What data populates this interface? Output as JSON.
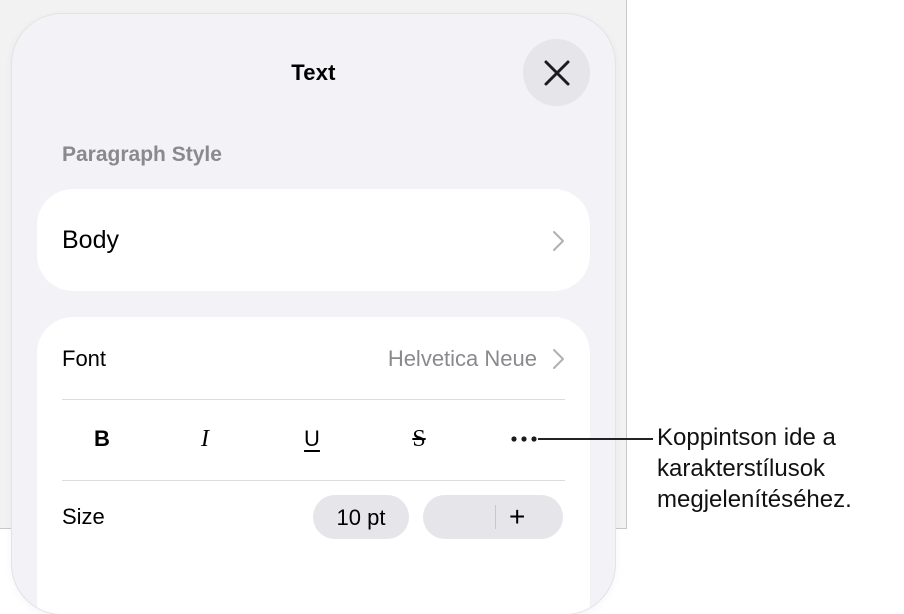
{
  "sheet": {
    "title": "Text",
    "close_icon": "close-icon"
  },
  "paragraph_style": {
    "header": "Paragraph Style",
    "value": "Body",
    "chevron_icon": "chevron-right-icon"
  },
  "font": {
    "label": "Font",
    "value": "Helvetica Neue",
    "chevron_icon": "chevron-right-icon"
  },
  "character_styles": {
    "bold": "B",
    "italic": "I",
    "underline": "U",
    "strikethrough": "S",
    "more_icon": "ellipsis-icon"
  },
  "size": {
    "label": "Size",
    "value": "10 pt",
    "increment_label": "+"
  },
  "callout": {
    "lines": [
      "Koppintson ide a",
      "karakterstílusok",
      "megjelenítéséhez."
    ]
  }
}
